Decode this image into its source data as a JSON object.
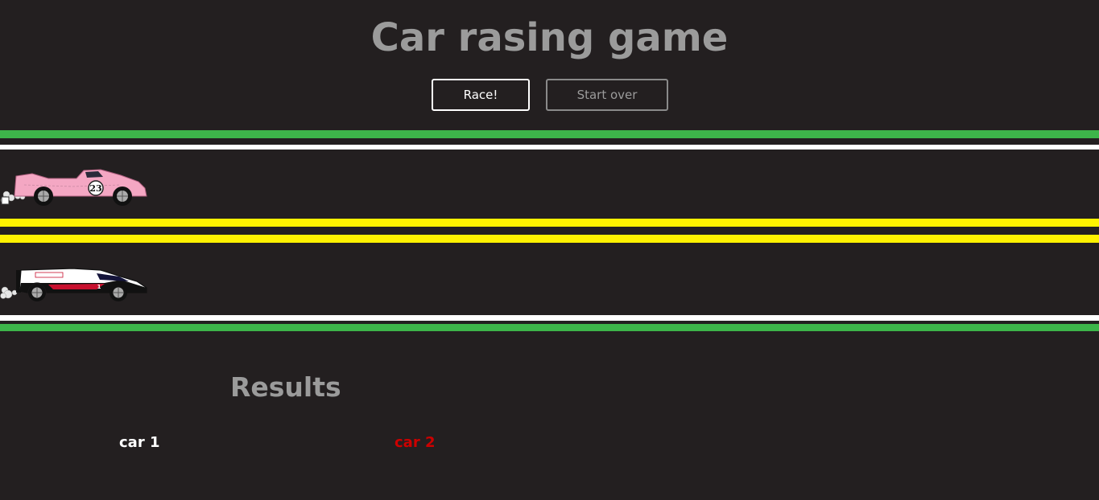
{
  "header": {
    "title": "Car rasing game"
  },
  "controls": {
    "race_label": "Race!",
    "start_over_label": "Start over"
  },
  "track": {
    "colors": {
      "grass": "#3db54a",
      "edge_line": "#ffffff",
      "center_line": "#fff200",
      "asphalt": "#231f20"
    },
    "cars": [
      {
        "name": "car 1",
        "icon": "pink-race-car-icon",
        "number": "23",
        "color": "#f4a7c3"
      },
      {
        "name": "car 2",
        "icon": "porsche-lmp-car-icon",
        "number": "1",
        "color": "#ffffff"
      }
    ]
  },
  "results": {
    "title": "Results",
    "items": [
      {
        "label": "car 1",
        "color": "#ffffff"
      },
      {
        "label": "car 2",
        "color": "#cc0000"
      }
    ]
  }
}
